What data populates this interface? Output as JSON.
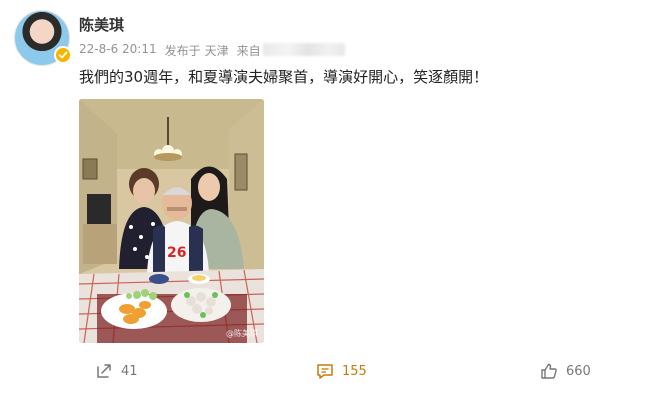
{
  "post": {
    "author": "陈美琪",
    "date": "22-8-6 20:11",
    "location_prefix": "发布于",
    "location": "天津",
    "source_prefix": "来自",
    "text": "我們的30週年，和夏導演夫婦聚首，導演好開心，笑逐顏開！",
    "photo_watermark": "@陈美琪"
  },
  "actions": {
    "repost_count": "41",
    "comment_count": "155",
    "like_count": "660"
  },
  "colors": {
    "comment_accent": "#c77b0a",
    "verified_badge": "#f7b500"
  },
  "icons": [
    "repost-icon",
    "comment-icon",
    "like-icon",
    "verified-icon"
  ]
}
